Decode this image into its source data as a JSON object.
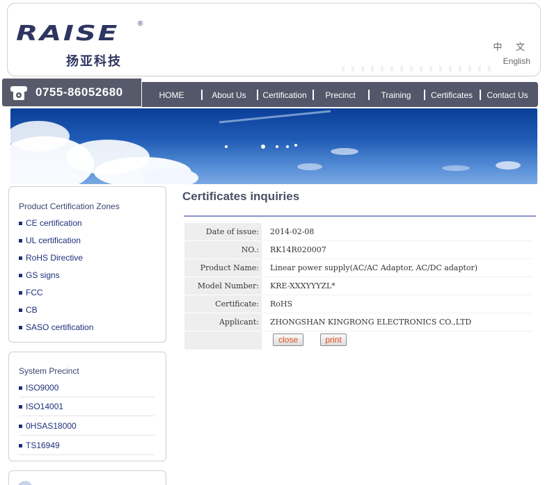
{
  "header": {
    "logo_text": "RAISE",
    "logo_reg": "®",
    "logo_cn": "扬亚科技",
    "lang_zh": "中 文",
    "lang_en": "English"
  },
  "phone": {
    "number": "0755-86052680",
    "icon": "phone-icon"
  },
  "nav": {
    "items": [
      "HOME",
      "About Us",
      "Certification",
      "Precinct",
      "Training",
      "Certificates",
      "Contact Us"
    ]
  },
  "sidebar": {
    "panel1": {
      "title": "Product Certification Zones",
      "items": [
        "CE certification",
        "UL certification",
        "RoHS Directive",
        "GS signs",
        "FCC",
        "CB",
        "SASO certification"
      ]
    },
    "panel2": {
      "title": "System Precinct",
      "items": [
        "ISO9000",
        "ISO14001",
        "0HSAS18000",
        "TS16949"
      ]
    }
  },
  "main": {
    "title": "Certificates inquiries",
    "rows": [
      {
        "label": "Date of issue:",
        "value": "2014-02-08"
      },
      {
        "label": "NO.:",
        "value": "RK14R020007"
      },
      {
        "label": "Product Name:",
        "value": "Linear power supply(AC/AC Adaptor, AC/DC adaptor)"
      },
      {
        "label": "Model Number:",
        "value": "KRE-XXXYYYZL*"
      },
      {
        "label": "Certificate:",
        "value": "RoHS"
      },
      {
        "label": "Applicant:",
        "value": "ZHONGSHAN KINGRONG ELECTRONICS CO.,LTD"
      }
    ],
    "close_label": "close",
    "print_label": "print"
  },
  "colors": {
    "nav_bg": "#545769",
    "accent_text": "#1d2f7a",
    "button_text": "#e14b14"
  }
}
